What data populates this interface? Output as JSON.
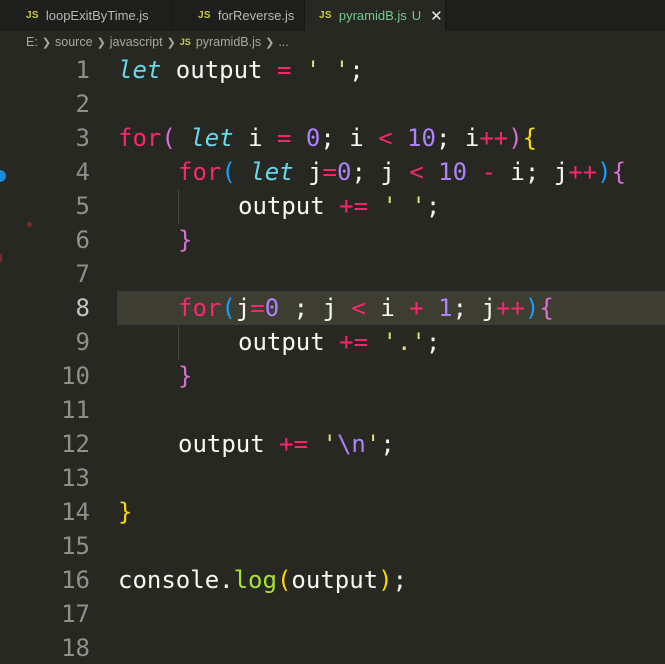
{
  "tabs": [
    {
      "icon": "JS",
      "label": "loopExitByTime.js",
      "active": false
    },
    {
      "icon": "JS",
      "label": "forReverse.js",
      "active": false
    },
    {
      "icon": "JS",
      "label": "pyramidB.js",
      "active": true,
      "status": "U",
      "close": "✕"
    }
  ],
  "breadcrumb": {
    "items": [
      "E:",
      "source",
      "javascript"
    ],
    "file_icon": "JS",
    "file": "pyramidB.js",
    "more": "..."
  },
  "editor": {
    "current_line": 8,
    "lines": [
      {
        "n": "1"
      },
      {
        "n": "2"
      },
      {
        "n": "3"
      },
      {
        "n": "4"
      },
      {
        "n": "5"
      },
      {
        "n": "6"
      },
      {
        "n": "7"
      },
      {
        "n": "8"
      },
      {
        "n": "9"
      },
      {
        "n": "10"
      },
      {
        "n": "11"
      },
      {
        "n": "12"
      },
      {
        "n": "13"
      },
      {
        "n": "14"
      },
      {
        "n": "15"
      },
      {
        "n": "16"
      },
      {
        "n": "17"
      },
      {
        "n": "18"
      }
    ],
    "code": {
      "l1": [
        "let",
        " output ",
        "=",
        " ",
        "' '",
        ";"
      ],
      "l3": [
        "for",
        "(",
        " ",
        "let",
        " i ",
        "=",
        " ",
        "0",
        "; i ",
        "<",
        " ",
        "10",
        "; i",
        "++",
        ")",
        "{"
      ],
      "l4": [
        "for",
        "(",
        " ",
        "let",
        " j",
        "=",
        "0",
        "; j ",
        "<",
        " ",
        "10",
        " ",
        "-",
        " i; j",
        "++",
        ")",
        "{"
      ],
      "l5": [
        "output ",
        "+=",
        " ",
        "' '",
        ";"
      ],
      "l6": [
        "}"
      ],
      "l8": [
        "for",
        "(",
        "j",
        "=",
        "0",
        " ; j ",
        "<",
        " i ",
        "+",
        " ",
        "1",
        "; j",
        "++",
        ")",
        "{"
      ],
      "l9": [
        "output ",
        "+=",
        " ",
        "'.'",
        ";"
      ],
      "l10": [
        "}"
      ],
      "l12": [
        "output ",
        "+=",
        " ",
        "'",
        "\\n",
        "'",
        ";"
      ],
      "l14": [
        "}"
      ],
      "l16": [
        "console",
        ".",
        "log",
        "(",
        "output",
        ")",
        ";"
      ]
    }
  },
  "colors": {
    "background": "#272822",
    "keyword": "#f92672",
    "storage": "#66d9ef",
    "number": "#ae81ff",
    "string": "#e6db74",
    "function": "#a6e22e",
    "bracket_level1": "#ffd700",
    "bracket_level2": "#da70d6",
    "bracket_level3": "#179fff"
  }
}
